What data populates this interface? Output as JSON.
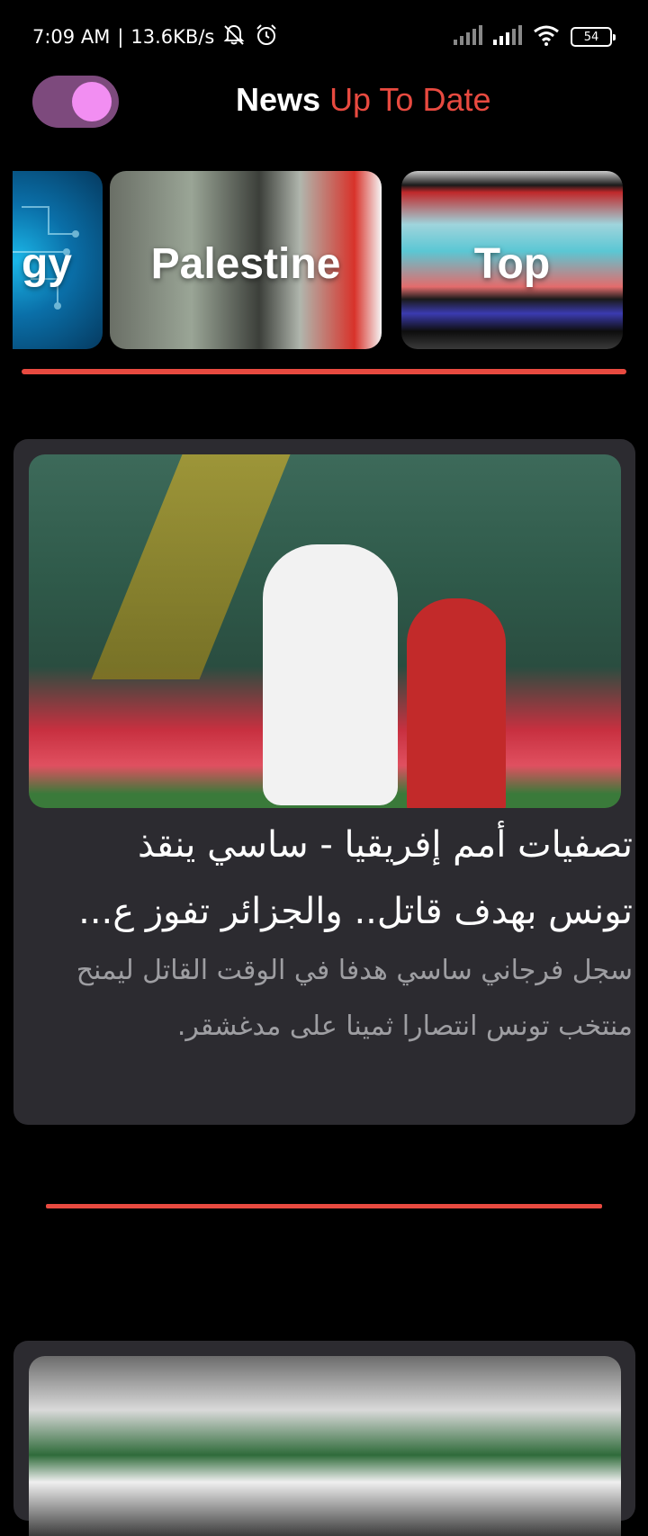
{
  "status_bar": {
    "time": "7:09 AM",
    "separator": "|",
    "net_speed": "13.6KB/s",
    "battery": "54",
    "icons": [
      "mute-notification-icon",
      "alarm-icon",
      "signal-icon",
      "signal-icon",
      "wifi-icon",
      "battery-icon"
    ]
  },
  "header": {
    "theme_toggle_on": true,
    "title_part1": "News",
    "title_part2": "Up To Date",
    "accent_color": "#e84a40"
  },
  "categories": [
    {
      "label": "gy"
    },
    {
      "label": "Palestine"
    },
    {
      "label": "Top"
    }
  ],
  "articles": [
    {
      "title": "تصفيات أمم إفريقيا - ساسي ينقذ تونس بهدف قاتل.. والجزائر تفوز ع...",
      "description": "سجل فرجاني ساسي هدفا في الوقت القاتل ليمنح منتخب تونس انتصارا ثمينا على مدغشقر."
    }
  ]
}
